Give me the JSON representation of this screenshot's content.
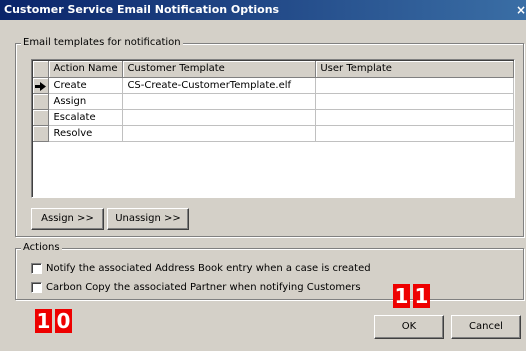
{
  "window": {
    "title": "Customer Service Email Notification Options",
    "close_glyph": "×"
  },
  "templates_group": {
    "legend": "Email templates for notification",
    "columns": [
      "Action Name",
      "Customer Template",
      "User Template"
    ],
    "current_row_icon": "arrow-right-icon",
    "rows": [
      {
        "action": "Create",
        "customer_template": "CS-Create-CustomerTemplate.elf",
        "user_template": ""
      },
      {
        "action": "Assign",
        "customer_template": "",
        "user_template": ""
      },
      {
        "action": "Escalate",
        "customer_template": "",
        "user_template": ""
      },
      {
        "action": "Resolve",
        "customer_template": "",
        "user_template": ""
      }
    ],
    "assign_label": "Assign >>",
    "unassign_label": "Unassign >>"
  },
  "actions_group": {
    "legend": "Actions",
    "notify_label": "Notify the associated Address Book entry when a case is created",
    "notify_checked": false,
    "cc_label": "Carbon Copy the associated Partner when notifying Customers",
    "cc_checked": false
  },
  "footer": {
    "ok_label": "OK",
    "cancel_label": "Cancel"
  },
  "annotations": {
    "badge_left": [
      "1",
      "0"
    ],
    "badge_right": [
      "1",
      "1"
    ],
    "color": "#ee0000"
  }
}
